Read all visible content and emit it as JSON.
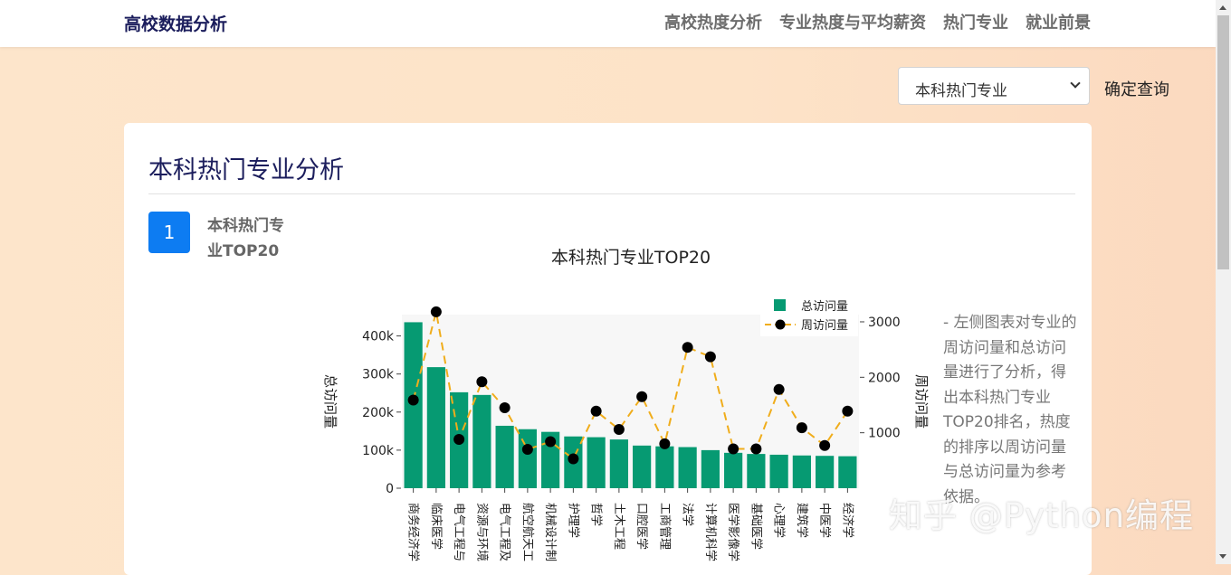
{
  "navbar": {
    "brand": "高校数据分析",
    "links": [
      "高校热度分析",
      "专业热度与平均薪资",
      "热门专业",
      "就业前景"
    ]
  },
  "query": {
    "selected": "本科热门专业",
    "confirm_label": "确定查询"
  },
  "card": {
    "title": "本科热门专业分析",
    "step_number": "1",
    "step_title": "本科热门专业TOP20",
    "note": "- 左侧图表对专业的周访问量和总访问量进行了分析，得出本科热门专业TOP20排名，热度的排序以周访问量与总访问量为参考依据。"
  },
  "watermark": "知乎 @Python编程",
  "colors": {
    "bar": "#069a72",
    "line": "#f0ad1b",
    "point": "#000000",
    "brand": "#1b1d5c",
    "badge": "#0d7cf2"
  },
  "chart_data": {
    "type": "bar",
    "title": "本科热门专业TOP20",
    "categories": [
      "商务经济学",
      "临床医学",
      "电气工程与",
      "资源与环境",
      "电气工程及",
      "航空航天工",
      "机械设计制",
      "护理学",
      "哲学",
      "土木工程",
      "口腔医学",
      "工商管理",
      "法学",
      "计算机科学",
      "医学影像学",
      "基础医学",
      "心理学",
      "建筑学",
      "中医学",
      "经济学"
    ],
    "series": [
      {
        "name": "总访问量",
        "type": "bar",
        "axis": "left",
        "values": [
          436000,
          318000,
          252000,
          245000,
          164000,
          155000,
          148000,
          136000,
          134000,
          128000,
          112000,
          110000,
          108000,
          100000,
          93000,
          90000,
          88000,
          86000,
          85000,
          84000
        ]
      },
      {
        "name": "周访问量",
        "type": "line",
        "axis": "right",
        "values": [
          1590,
          3180,
          880,
          1920,
          1450,
          700,
          840,
          530,
          1390,
          1060,
          1650,
          800,
          2540,
          2370,
          710,
          710,
          1780,
          1090,
          770,
          1390
        ]
      }
    ],
    "ylabel_left": "总访问量",
    "ylabel_right": "周访问量",
    "y_left_ticks": [
      "0",
      "100k",
      "200k",
      "300k",
      "400k"
    ],
    "y_right_ticks": [
      "1000",
      "2000",
      "3000"
    ],
    "ylim_left": [
      0,
      456000
    ],
    "ylim_right": [
      0,
      3130
    ],
    "legend": "top-right"
  }
}
